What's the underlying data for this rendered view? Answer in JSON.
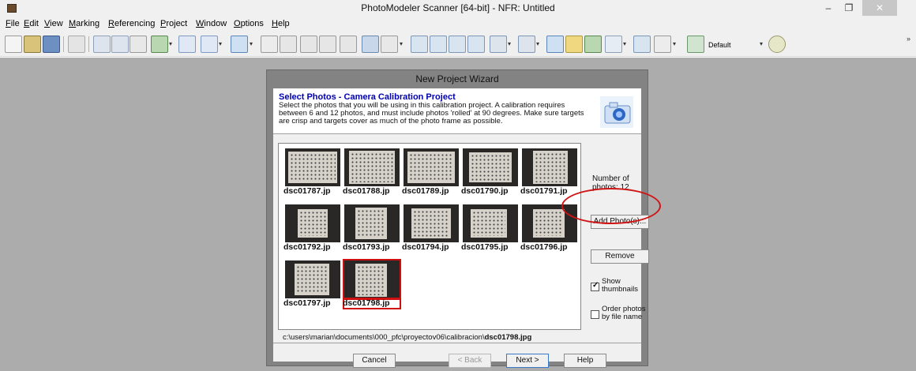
{
  "window": {
    "title": "PhotoModeler Scanner [64-bit] - NFR: Untitled",
    "min_glyph": "–",
    "max_glyph": "❐",
    "close_glyph": "✕"
  },
  "menu": [
    "File",
    "Edit",
    "View",
    "Marking",
    "Referencing",
    "Project",
    "Window",
    "Options",
    "Help"
  ],
  "toolbar": {
    "display_dropdown_value": "Default",
    "overflow_glyph": "»"
  },
  "dialog": {
    "title": "New Project Wizard",
    "heading": "Select Photos - Camera Calibration Project",
    "description": "Select the photos that you will be using in this calibration project. A calibration requires between 6 and 12 photos, and must include photos 'rolled' at 90 degrees. Make sure targets are crisp and targets cover as much of the photo frame as possible.",
    "photos": [
      {
        "name": "dsc01787.jp"
      },
      {
        "name": "dsc01788.jp"
      },
      {
        "name": "dsc01789.jp"
      },
      {
        "name": "dsc01790.jp"
      },
      {
        "name": "dsc01791.jp"
      },
      {
        "name": "dsc01792.jp"
      },
      {
        "name": "dsc01793.jp"
      },
      {
        "name": "dsc01794.jp"
      },
      {
        "name": "dsc01795.jp"
      },
      {
        "name": "dsc01796.jp"
      },
      {
        "name": "dsc01797.jp"
      },
      {
        "name": "dsc01798.jp",
        "selected": true
      }
    ],
    "path_prefix": "c:\\users\\marian\\documents\\000_pfc\\proyectov06\\calibracion\\",
    "path_file": "dsc01798.jpg",
    "photo_count_label": "Number of photos: 12",
    "add_button": "Add Photo(s)...",
    "remove_button": "Remove",
    "show_thumbnails_label": "Show thumbnails",
    "show_thumbnails_checked": true,
    "order_by_name_label": "Order photos by file name",
    "order_by_name_checked": false,
    "cancel_button": "Cancel",
    "back_button": "< Back",
    "next_button": "Next >",
    "help_button": "Help"
  }
}
